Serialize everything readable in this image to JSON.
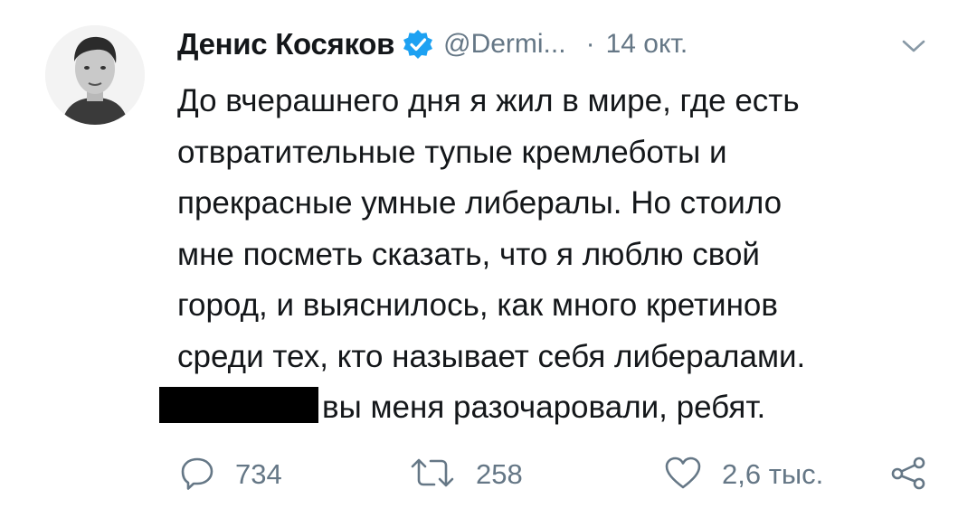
{
  "tweet": {
    "author_name": "Денис Косяков",
    "handle": "@Dermi...",
    "separator": "·",
    "timestamp": "14 окт.",
    "verified": true,
    "text_lines": [
      "До вчерашнего дня я жил в мире, где есть",
      "отвратительные тупые кремлеботы и",
      "прекрасные умные либералы. Но стоило",
      "мне посметь сказать, что я люблю свой",
      "город, и выяснилось, как много кретинов",
      "среди тех, кто называет себя либералами.",
      "вы меня разочаровали, ребят."
    ]
  },
  "actions": {
    "replies": "734",
    "retweets": "258",
    "likes": "2,6 тыс."
  },
  "colors": {
    "text": "#14171a",
    "muted": "#657786",
    "verified_badge": "#1da1f2",
    "redaction": "#000000"
  },
  "icons": {
    "verified": "verified-badge-icon",
    "menu": "chevron-down-icon",
    "reply": "reply-icon",
    "retweet": "retweet-icon",
    "like": "heart-icon",
    "share": "share-icon"
  }
}
